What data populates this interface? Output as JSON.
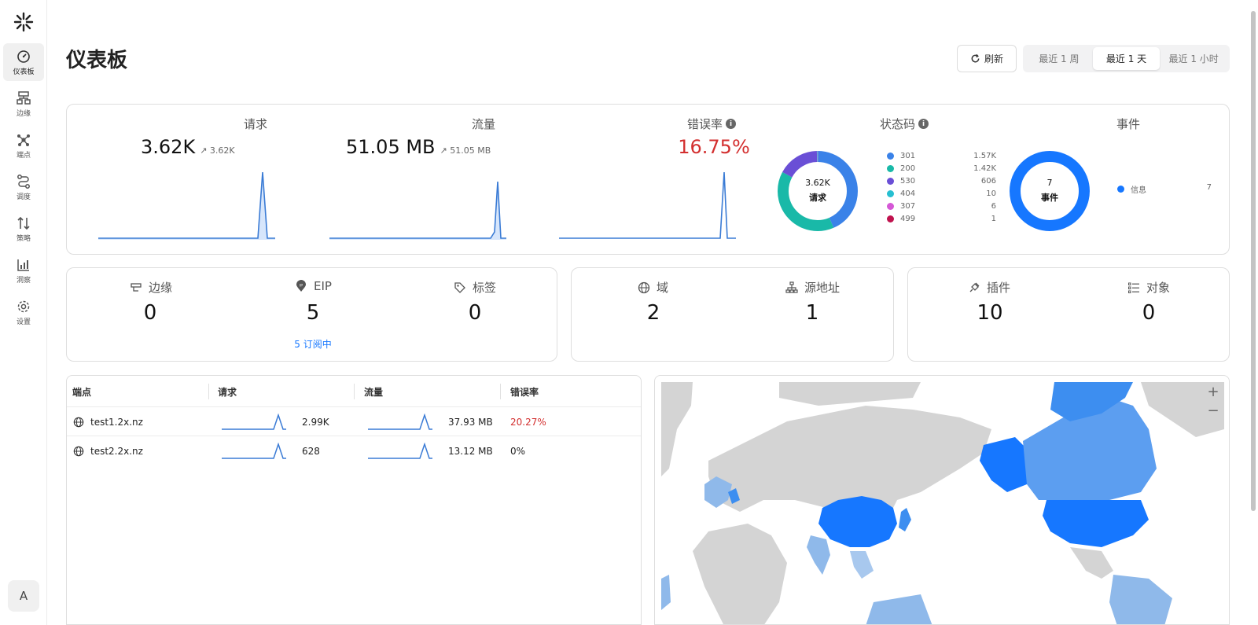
{
  "sidebar": {
    "items": [
      {
        "label": "仪表板",
        "icon": "gauge-icon"
      },
      {
        "label": "边缘",
        "icon": "edge-icon"
      },
      {
        "label": "端点",
        "icon": "endpoint-icon"
      },
      {
        "label": "调度",
        "icon": "route-icon"
      },
      {
        "label": "策略",
        "icon": "arrows-updown-icon"
      },
      {
        "label": "洞察",
        "icon": "insights-icon"
      },
      {
        "label": "设置",
        "icon": "gear-icon"
      }
    ],
    "avatar": "A"
  },
  "header": {
    "title": "仪表板",
    "refresh_label": "刷新",
    "ranges": [
      "最近 1 周",
      "最近 1 天",
      "最近 1 小时"
    ],
    "active_range": "最近 1 天"
  },
  "stats": {
    "requests": {
      "label": "请求",
      "value": "3.62K",
      "trend": "3.62K"
    },
    "traffic": {
      "label": "流量",
      "value": "51.05 MB",
      "trend": "51.05 MB"
    },
    "error_rate": {
      "label": "错误率",
      "value": "16.75%"
    },
    "status_codes": {
      "label": "状态码",
      "center_value": "3.62K",
      "center_label": "请求",
      "items": [
        {
          "code": "301",
          "count": "1.57K",
          "color": "#3a82e8"
        },
        {
          "code": "200",
          "count": "1.42K",
          "color": "#19b9a8"
        },
        {
          "code": "530",
          "count": "606",
          "color": "#6a4fd6"
        },
        {
          "code": "404",
          "count": "10",
          "color": "#26bfd1"
        },
        {
          "code": "307",
          "count": "6",
          "color": "#d558d6"
        },
        {
          "code": "499",
          "count": "1",
          "color": "#c0124e"
        }
      ]
    },
    "events": {
      "label": "事件",
      "center_value": "7",
      "center_label": "事件",
      "items": [
        {
          "name": "信息",
          "count": "7",
          "color": "#1677ff"
        }
      ]
    }
  },
  "counts": {
    "edge": {
      "label": "边缘",
      "value": "0"
    },
    "eip": {
      "label": "EIP",
      "value": "5",
      "link": "5 订阅中"
    },
    "tags": {
      "label": "标签",
      "value": "0"
    },
    "domains": {
      "label": "域",
      "value": "2"
    },
    "origins": {
      "label": "源地址",
      "value": "1"
    },
    "plugins": {
      "label": "插件",
      "value": "10"
    },
    "objects": {
      "label": "对象",
      "value": "0"
    }
  },
  "table": {
    "headers": [
      "端点",
      "请求",
      "流量",
      "错误率"
    ],
    "rows": [
      {
        "name": "test1.2x.nz",
        "requests": "2.99K",
        "traffic": "37.93 MB",
        "error": "20.27%",
        "error_color": "#d32f2f"
      },
      {
        "name": "test2.2x.nz",
        "requests": "628",
        "traffic": "13.12 MB",
        "error": "0%",
        "error_color": "#222222"
      }
    ]
  },
  "map": {
    "zoom_in": "+",
    "zoom_out": "−"
  },
  "colors": {
    "accent": "#1677ff",
    "error": "#d32f2f",
    "sparkline": "#3a7bd5"
  }
}
